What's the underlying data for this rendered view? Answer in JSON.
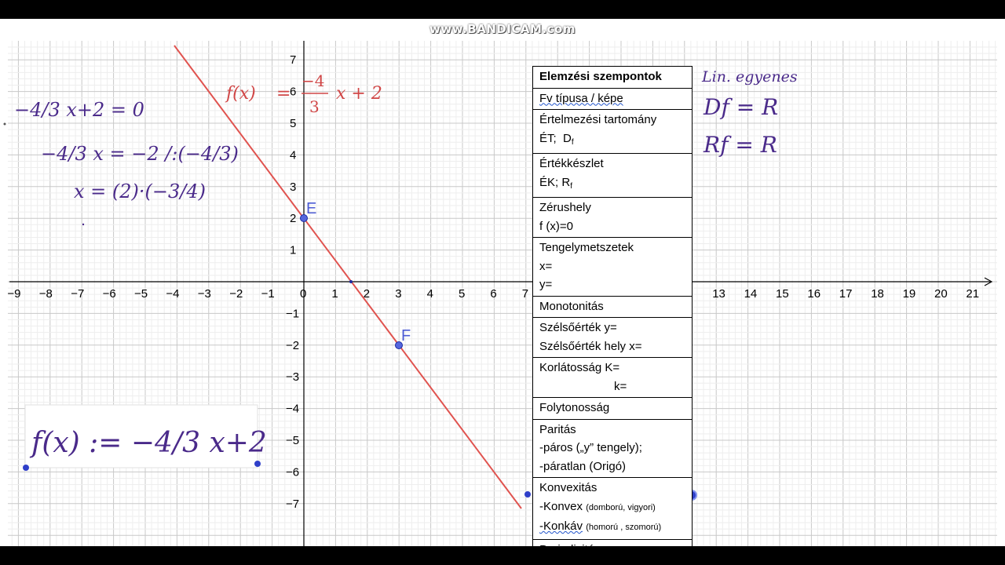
{
  "watermark": "www.BANDICAM.com",
  "graph": {
    "x_tick_labels": [
      "-9",
      "-8",
      "-7",
      "-6",
      "-5",
      "-4",
      "-3",
      "-2",
      "-1",
      "0",
      "1",
      "2",
      "3",
      "4",
      "5",
      "6",
      "7",
      "13",
      "14",
      "15",
      "16",
      "17",
      "18",
      "19",
      "20",
      "21"
    ],
    "y_tick_labels": [
      "7",
      "6",
      "5",
      "4",
      "3",
      "2",
      "1",
      "-1",
      "-2",
      "-3",
      "-4",
      "-5",
      "-6",
      "-7"
    ],
    "function_label": {
      "prefix": "f(x)",
      "eq": "=",
      "num": "−4",
      "den": "3",
      "suffix": "x + 2"
    },
    "point_e": "E",
    "point_f": "F",
    "line_color": "#e0534f",
    "point_color": "#2f3fc9"
  },
  "handwriting": {
    "left_eq1": "−4/3 x+2 = 0",
    "left_eq2": "−4/3 x = −2   /:(−4/3)",
    "left_eq3": "x = (2)·(−3/4)",
    "box_formula": "f(x) := −4/3 x+2",
    "right_note": "Lin. egyenes",
    "right_df": "Df = R",
    "right_rf": "Rf = R"
  },
  "table": {
    "header": "Elemzési szempontok",
    "fv_tipusa": "Fv típusa / képe",
    "ertelmezesi": "Értelmezési tartomány",
    "et_df": "ÉT;",
    "df": "D",
    "df_sub": "f",
    "ertekkeszlet": "Értékkészlet",
    "ek": "ÉK; R",
    "ek_sub": "f",
    "zerushely": "Zérushely",
    "fx0": "f (x)=0",
    "tengely": "Tengelymetszetek",
    "x_eq": "x=",
    "y_eq": "y=",
    "monotonitas": "Monotonitás",
    "szelso_y": "Szélsőérték y=",
    "szelso_x": "Szélsőérték hely x=",
    "korlat_k": "Korlátosság K=",
    "korlat_kk": "k=",
    "folytonossag": "Folytonosság",
    "paritas": "Paritás",
    "paros": "-páros („y” tengely);",
    "paratlan": "-páratlan (Origó)",
    "konvexitas": "Konvexitás",
    "konvex": "-Konvex",
    "konvex_small": "(domború, vigyori)",
    "konkav": "-Konkáv",
    "konkav_small": "(homorú , szomorú)",
    "periodicitas": "Periodicitás"
  }
}
